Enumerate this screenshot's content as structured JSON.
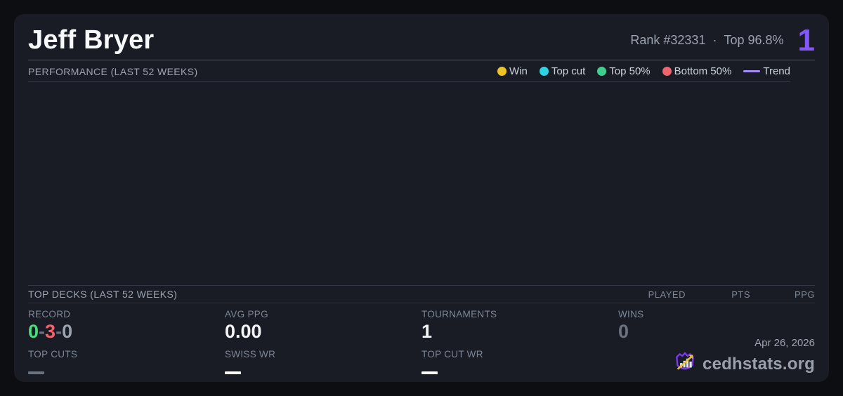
{
  "header": {
    "player_name": "Jeff Bryer",
    "rank_text": "Rank #32331",
    "separator": "·",
    "top_percent_text": "Top 96.8%",
    "big_stat": "1",
    "accent_color": "#8158f6"
  },
  "performance": {
    "title": "PERFORMANCE (LAST 52 WEEKS)",
    "chart_empty": true,
    "legend": [
      {
        "label": "Win",
        "color": "#eec424",
        "marker": "dot"
      },
      {
        "label": "Top cut",
        "color": "#2cd3e1",
        "marker": "dot"
      },
      {
        "label": "Top 50%",
        "color": "#3ecf8e",
        "marker": "dot"
      },
      {
        "label": "Bottom 50%",
        "color": "#f0646e",
        "marker": "dot"
      },
      {
        "label": "Trend",
        "color": "#a78bfa",
        "marker": "line"
      }
    ]
  },
  "top_decks": {
    "title": "TOP DECKS (LAST 52 WEEKS)",
    "columns": [
      "PLAYED",
      "PTS",
      "PPG"
    ],
    "rows": []
  },
  "stats": {
    "record": {
      "label": "RECORD",
      "wins": "0",
      "losses": "3",
      "draws": "0",
      "separator": "-",
      "win_color": "#4ade80",
      "loss_color": "#f0646e",
      "draw_color": "#9ca3af"
    },
    "avg_ppg": {
      "label": "AVG PPG",
      "value": "0.00"
    },
    "tournaments": {
      "label": "TOURNAMENTS",
      "value": "1"
    },
    "wins": {
      "label": "WINS",
      "value": "0"
    },
    "top_cuts": {
      "label": "TOP CUTS",
      "value": "—",
      "dash_color": "#6b7280"
    },
    "swiss_wr": {
      "label": "SWISS WR",
      "value": "—",
      "dash_color": "#ffffff"
    },
    "top_cut_wr": {
      "label": "TOP CUT WR",
      "value": "—",
      "dash_color": "#ffffff"
    }
  },
  "footer": {
    "date": "Apr 26, 2026",
    "brand": "cedhstats.org",
    "logo_icon": "shield-barchart-arrow"
  }
}
